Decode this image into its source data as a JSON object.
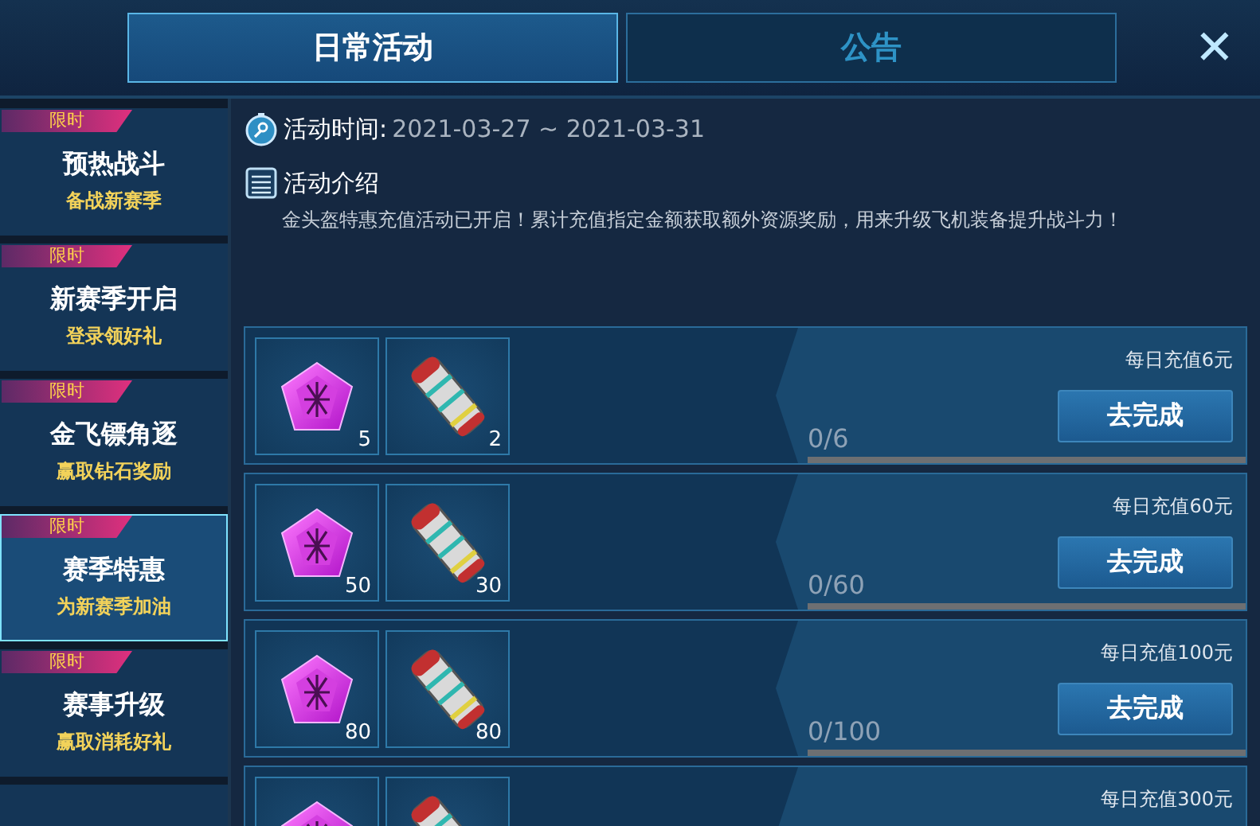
{
  "tabs": [
    {
      "label": "日常活动",
      "selected": true
    },
    {
      "label": "公告",
      "selected": false
    }
  ],
  "close": {
    "label": "✕"
  },
  "sidebar": {
    "items": [
      {
        "badge": "限时",
        "title": "预热战斗",
        "subtitle": "备战新赛季",
        "selected": false
      },
      {
        "badge": "限时",
        "title": "新赛季开启",
        "subtitle": "登录领好礼",
        "selected": false
      },
      {
        "badge": "限时",
        "title": "金飞镖角逐",
        "subtitle": "赢取钻石奖励",
        "selected": false
      },
      {
        "badge": "限时",
        "title": "赛季特惠",
        "subtitle": "为新赛季加油",
        "selected": true
      },
      {
        "badge": "限时",
        "title": "赛事升级",
        "subtitle": "赢取消耗好礼",
        "selected": false
      }
    ]
  },
  "activity": {
    "time_label": "活动时间:",
    "time_value": "2021-03-27 ~ 2021-03-31",
    "intro_title": "活动介绍",
    "intro_text": "金头盔特惠充值活动已开启！累计充值指定金额获取额外资源奖励，用来升级飞机装备提升战斗力！"
  },
  "tasks": [
    {
      "rewards": [
        {
          "kind": "gem",
          "count": "5"
        },
        {
          "kind": "missile",
          "count": "2"
        }
      ],
      "title": "每日充值6元",
      "progress": "0/6",
      "level": 0,
      "button": "去完成"
    },
    {
      "rewards": [
        {
          "kind": "gem",
          "count": "50"
        },
        {
          "kind": "missile",
          "count": "30"
        }
      ],
      "title": "每日充值60元",
      "progress": "0/60",
      "level": 0,
      "button": "去完成"
    },
    {
      "rewards": [
        {
          "kind": "gem",
          "count": "80"
        },
        {
          "kind": "missile",
          "count": "80"
        }
      ],
      "title": "每日充值100元",
      "progress": "0/100",
      "level": 0,
      "button": "去完成"
    },
    {
      "rewards": [
        {
          "kind": "gem"
        },
        {
          "kind": "missile"
        }
      ],
      "title": "每日充值300元"
    }
  ]
}
